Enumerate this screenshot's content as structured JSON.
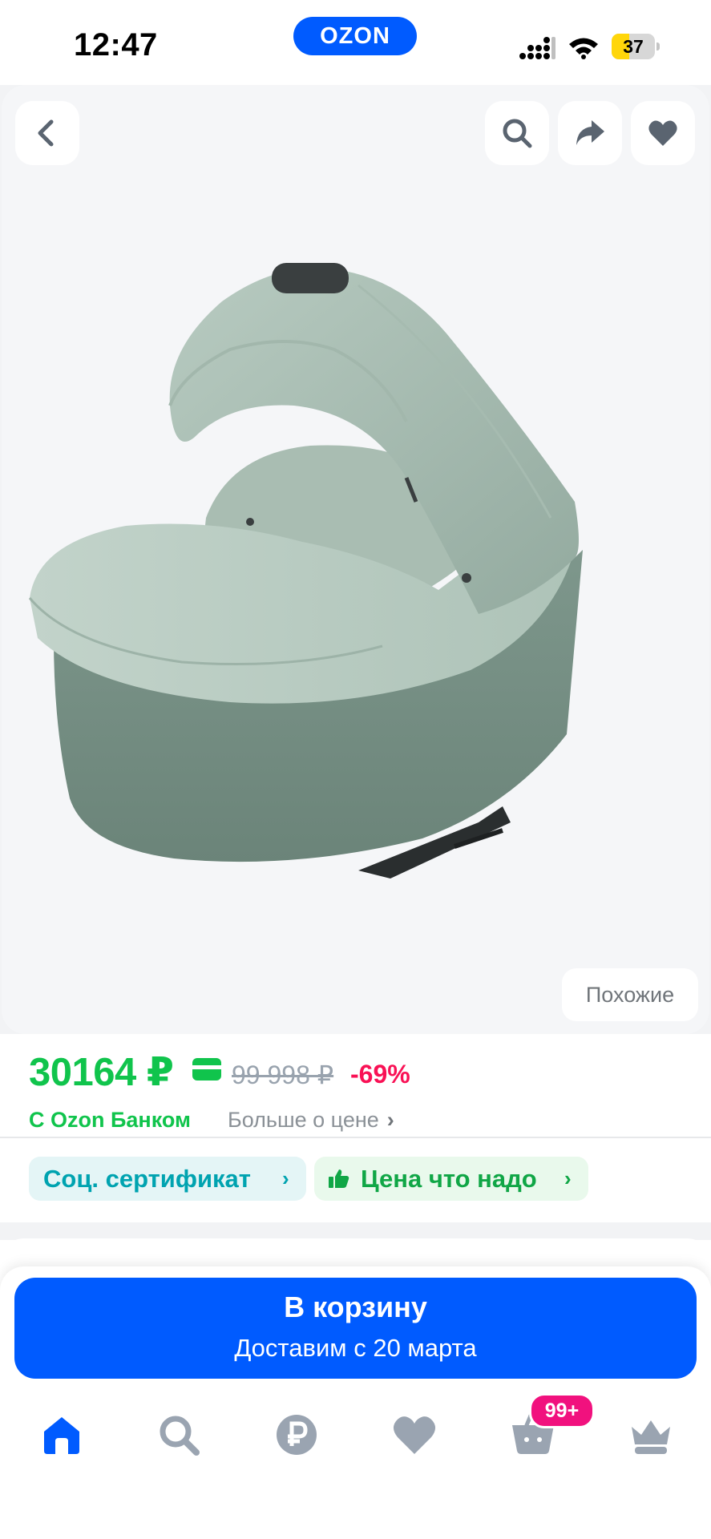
{
  "status_bar": {
    "time": "12:47",
    "app_logo": "OZON",
    "battery": "37"
  },
  "header_actions": {
    "back": "chevron-left-icon",
    "search": "search-icon",
    "share": "share-icon",
    "favorite": "heart-icon"
  },
  "gallery": {
    "similar_label": "Похожие"
  },
  "price": {
    "current": "30164 ₽",
    "old": "99 998 ₽",
    "discount": "-69%",
    "bank_label": "С Ozon Банком",
    "more_label": "Больше о цене",
    "chevron": "›"
  },
  "chips": {
    "cert_label": "Соц. сертификат",
    "good_price_label": "Цена что надо",
    "chevron": "›"
  },
  "cart": {
    "button_label": "В корзину",
    "delivery_label": "Доставим с 20 марта"
  },
  "tabbar": {
    "items": [
      "home-icon",
      "search-icon",
      "ruble-icon",
      "heart-icon",
      "cart-icon",
      "crown-icon"
    ],
    "cart_badge": "99+"
  },
  "colors": {
    "brand_blue": "#005bff",
    "price_green": "#10c44c",
    "discount_red": "#f91155",
    "badge_pink": "#f1117e",
    "cert_teal": "#00a3b0",
    "tab_active": "#005bff",
    "tab_inactive": "#9aa4b1"
  }
}
